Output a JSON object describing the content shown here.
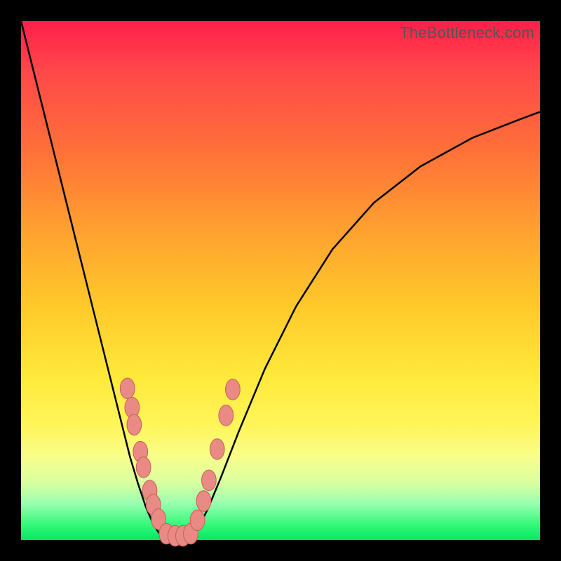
{
  "watermark": "TheBottleneck.com",
  "chart_data": {
    "type": "line",
    "title": "",
    "xlabel": "",
    "ylabel": "",
    "xlim": [
      0,
      1
    ],
    "ylim": [
      0,
      1
    ],
    "note": "Axes are unit-normalized to the plot rectangle; no numeric tick labels are shown in the source image. y=0 is the bottom (green) edge, y=1 is the top (red) edge.",
    "series": [
      {
        "name": "left-branch",
        "x": [
          0.0,
          0.03,
          0.06,
          0.09,
          0.12,
          0.15,
          0.18,
          0.195,
          0.21,
          0.225,
          0.24,
          0.255,
          0.268,
          0.28
        ],
        "y": [
          1.0,
          0.88,
          0.76,
          0.64,
          0.52,
          0.4,
          0.28,
          0.22,
          0.16,
          0.11,
          0.065,
          0.03,
          0.01,
          0.0
        ]
      },
      {
        "name": "valley-floor",
        "x": [
          0.28,
          0.295,
          0.31,
          0.325
        ],
        "y": [
          0.0,
          0.0,
          0.0,
          0.0
        ]
      },
      {
        "name": "right-branch",
        "x": [
          0.325,
          0.34,
          0.36,
          0.385,
          0.42,
          0.47,
          0.53,
          0.6,
          0.68,
          0.77,
          0.87,
          0.96,
          1.0
        ],
        "y": [
          0.0,
          0.02,
          0.06,
          0.12,
          0.21,
          0.33,
          0.45,
          0.56,
          0.65,
          0.72,
          0.775,
          0.81,
          0.825
        ]
      }
    ],
    "beads": {
      "description": "Salmon-colored oval markers overlaid on the curve near the valley",
      "rx": 0.014,
      "ry": 0.02,
      "points": [
        {
          "x": 0.205,
          "y": 0.292
        },
        {
          "x": 0.214,
          "y": 0.255
        },
        {
          "x": 0.218,
          "y": 0.222
        },
        {
          "x": 0.23,
          "y": 0.17
        },
        {
          "x": 0.236,
          "y": 0.14
        },
        {
          "x": 0.248,
          "y": 0.095
        },
        {
          "x": 0.255,
          "y": 0.068
        },
        {
          "x": 0.265,
          "y": 0.04
        },
        {
          "x": 0.28,
          "y": 0.012
        },
        {
          "x": 0.297,
          "y": 0.008
        },
        {
          "x": 0.312,
          "y": 0.008
        },
        {
          "x": 0.327,
          "y": 0.012
        },
        {
          "x": 0.34,
          "y": 0.038
        },
        {
          "x": 0.352,
          "y": 0.075
        },
        {
          "x": 0.362,
          "y": 0.115
        },
        {
          "x": 0.378,
          "y": 0.175
        },
        {
          "x": 0.395,
          "y": 0.24
        },
        {
          "x": 0.408,
          "y": 0.29
        }
      ]
    },
    "background_gradient": {
      "orientation": "vertical",
      "stops": [
        {
          "pos": 0.0,
          "color": "#ff1f4b"
        },
        {
          "pos": 0.25,
          "color": "#ff7038"
        },
        {
          "pos": 0.55,
          "color": "#ffc92a"
        },
        {
          "pos": 0.78,
          "color": "#fff55a"
        },
        {
          "pos": 0.93,
          "color": "#98ffb0"
        },
        {
          "pos": 1.0,
          "color": "#04e763"
        }
      ]
    }
  }
}
